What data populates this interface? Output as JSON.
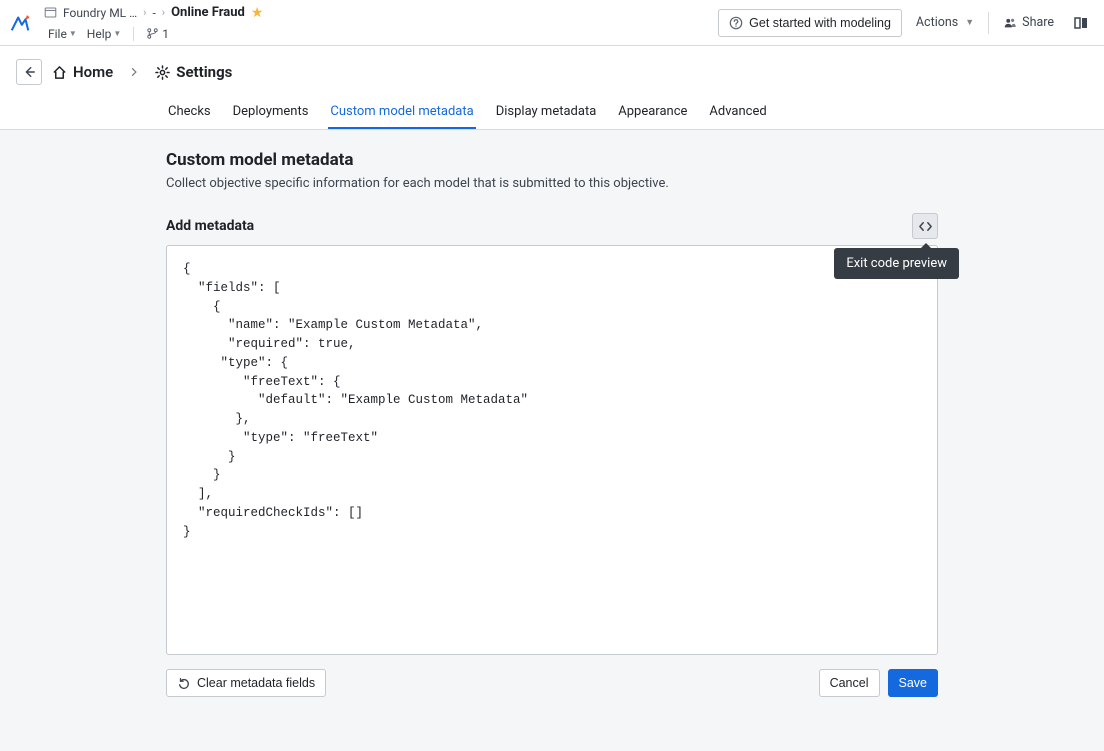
{
  "topbar": {
    "breadcrumb_app": "Foundry ML …",
    "breadcrumb_sep1": "›",
    "breadcrumb_mid": "-",
    "breadcrumb_sep2": "›",
    "breadcrumb_current": "Online Fraud",
    "menu_file": "File",
    "menu_help": "Help",
    "branch_count": "1",
    "get_started": "Get started with modeling",
    "actions": "Actions",
    "share": "Share"
  },
  "subheader": {
    "home": "Home",
    "settings": "Settings"
  },
  "tabs": {
    "checks": "Checks",
    "deployments": "Deployments",
    "custom": "Custom model metadata",
    "display": "Display metadata",
    "appearance": "Appearance",
    "advanced": "Advanced"
  },
  "page": {
    "title": "Custom model metadata",
    "desc": "Collect objective specific information for each model that is submitted to this objective.",
    "section_label": "Add metadata",
    "tooltip": "Exit code preview",
    "code": "{\n  \"fields\": [\n    {\n      \"name\": \"Example Custom Metadata\",\n      \"required\": true,\n     \"type\": {\n        \"freeText\": {\n          \"default\": \"Example Custom Metadata\"\n       },\n        \"type\": \"freeText\"\n      }\n    }\n  ],\n  \"requiredCheckIds\": []\n}",
    "clear_btn": "Clear metadata fields",
    "cancel_btn": "Cancel",
    "save_btn": "Save"
  }
}
